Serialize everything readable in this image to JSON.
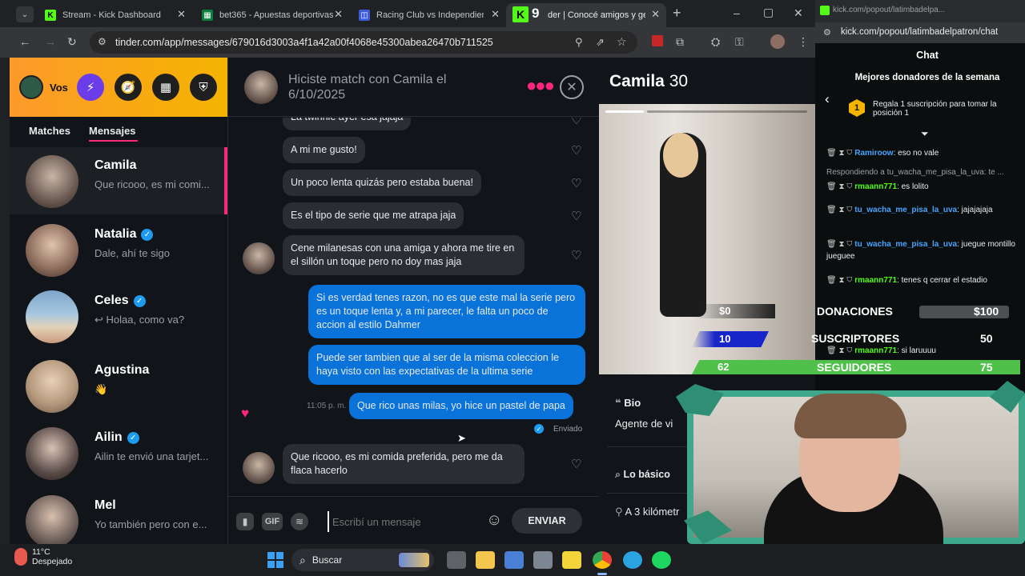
{
  "browser": {
    "tabs": [
      {
        "title": "Stream - Kick Dashboard",
        "fav_color": "#53fc18",
        "fav_letter": "K"
      },
      {
        "title": "bet365 - Apuestas deportivas e",
        "fav_color": "#0b7d3e",
        "fav_letter": "▦"
      },
      {
        "title": "Racing Club vs Independiente",
        "fav_color": "#3b5bdb",
        "fav_letter": "◫"
      },
      {
        "title": "der | Conocé amigos y gent",
        "fav_color": "#53fc18",
        "fav_letter": "K"
      }
    ],
    "active_tab_badge": "9",
    "new_tab": "+",
    "url": "tinder.com/app/messages/679016d3003a4f1a42a00f4068e45300abea26470b711525",
    "window_controls": [
      "–",
      "▢",
      "✕"
    ]
  },
  "tinder": {
    "profile_label": "Vos",
    "side_tabs": {
      "matches": "Matches",
      "messages": "Mensajes"
    },
    "conversations": [
      {
        "name": "Camila",
        "preview": "Que ricooo, es mi comi...",
        "verified": false,
        "color": "#6b5a52"
      },
      {
        "name": "Natalia",
        "preview": "Dale, ahí te sigo",
        "verified": true,
        "color": "#8a6a5a"
      },
      {
        "name": "Celes",
        "preview": "↩ Holaa, como va?",
        "verified": true,
        "color": "#7ea6c9"
      },
      {
        "name": "Agustina",
        "preview": "👋",
        "verified": false,
        "color": "#b59a7d"
      },
      {
        "name": "Ailin",
        "preview": "Ailin te envió una tarjet...",
        "verified": true,
        "color": "#5a4c49"
      },
      {
        "name": "Mel",
        "preview": "Yo también pero con e...",
        "verified": false,
        "color": "#6d5f5a"
      }
    ],
    "chat_header": {
      "line1": "Hiciste match con Camila el",
      "line2": "6/10/2025"
    },
    "messages": [
      {
        "text": "La twinnie ayer esa jajaja",
        "from": "them"
      },
      {
        "text": "A mi me gusto!",
        "from": "them"
      },
      {
        "text": "Un poco lenta quizás pero estaba buena!",
        "from": "them"
      },
      {
        "text": "Es el tipo de serie que me atrapa jaja",
        "from": "them"
      },
      {
        "text": "Cene milanesas con una amiga y ahora me tire en el sillón un toque pero no doy mas jaja",
        "from": "them"
      },
      {
        "text": "Si es verdad tenes razon, no es que este mal la serie pero es un toque lenta y, a mi parecer, le falta un poco de accion al estilo Dahmer",
        "from": "me"
      },
      {
        "text": "Puede ser tambien que al ser de la misma coleccion le haya visto con las expectativas de la ultima serie",
        "from": "me"
      },
      {
        "text": "Que rico unas milas, yo hice un pastel de papa",
        "from": "me"
      },
      {
        "text": "Que ricooo, es mi comida preferida, pero me da flaca hacerlo",
        "from": "them"
      }
    ],
    "timestamp": "11:05 p. m.",
    "sent_label": "Enviado",
    "compose": {
      "gif": "GIF",
      "placeholder": "Escribí un mensaje",
      "send": "ENVIAR"
    },
    "profile": {
      "name": "Camila",
      "age": "30",
      "bio_title": "Bio",
      "bio_text": "Agente de vi",
      "basics_title": "Lo básico",
      "distance": "A 3 kilómetr"
    }
  },
  "kick": {
    "url": "kick.com/popout/latimbadelpa...",
    "page_url": "kick.com/popout/latimbadelpatron/chat",
    "chat_title": "Chat",
    "donors_title": "Mejores donadores de la semana",
    "donor_rank": "1",
    "donor_text": "Regala 1 suscripción para tomar la posición 1",
    "messages": [
      {
        "user": "Ramiroow",
        "text": "eso no vale",
        "color": "#4aa3ff"
      },
      {
        "reply": "Respondiendo a tu_wacha_me_pisa_la_uva: te ..."
      },
      {
        "user": "rmaann771",
        "text": "es lolito",
        "color": "#53fc18"
      },
      {
        "user": "tu_wacha_me_pisa_la_uva",
        "text": "jajajajaja",
        "color": "#4aa3ff"
      },
      {
        "user": "tu_wacha_me_pisa_la_uva",
        "text": "juegue montillo jueguee",
        "color": "#4aa3ff"
      },
      {
        "user": "rmaann771",
        "text": "tenes q cerrar el estadio",
        "color": "#53fc18"
      },
      {
        "user": "rmaann771",
        "text": "si laruuuu",
        "color": "#53fc18"
      }
    ]
  },
  "overlay": {
    "money": "$0",
    "subs_count": "10",
    "followers_count": "62",
    "donaciones_label": "DONACIONES",
    "donaciones_value": "$100",
    "suscriptores_label": "SUSCRIPTORES",
    "suscriptores_value": "50",
    "seguidores_label": "SEGUIDORES",
    "seguidores_value": "75"
  },
  "taskbar": {
    "weather_temp": "11°C",
    "weather_desc": "Despejado",
    "search": "Buscar"
  }
}
